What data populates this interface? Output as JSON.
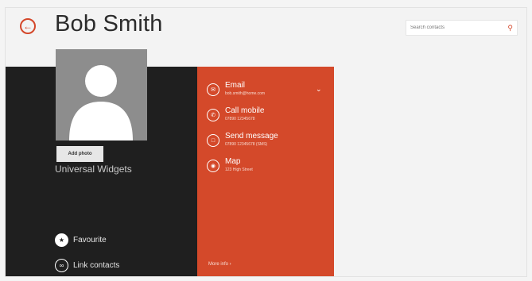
{
  "header": {
    "title": "Bob Smith"
  },
  "search": {
    "placeholder": "Search contacts"
  },
  "profile": {
    "add_photo": "Add photo",
    "company": "Universal Widgets",
    "favourite": "Favourite",
    "link_contacts": "Link contacts"
  },
  "contact_actions": [
    {
      "label": "Email",
      "sub": "bob.smith@home.com",
      "icon": "email-icon"
    },
    {
      "label": "Call mobile",
      "sub": "07890 12345678",
      "icon": "phone-icon"
    },
    {
      "label": "Send message",
      "sub": "07890 12345678 (SMS)",
      "icon": "message-icon"
    },
    {
      "label": "Map",
      "sub": "123 High Street",
      "icon": "map-pin-icon"
    }
  ],
  "more_info": "More info ›",
  "colors": {
    "accent": "#d4492a",
    "dark_panel": "#1f1f1f",
    "background": "#f3f3f3"
  }
}
